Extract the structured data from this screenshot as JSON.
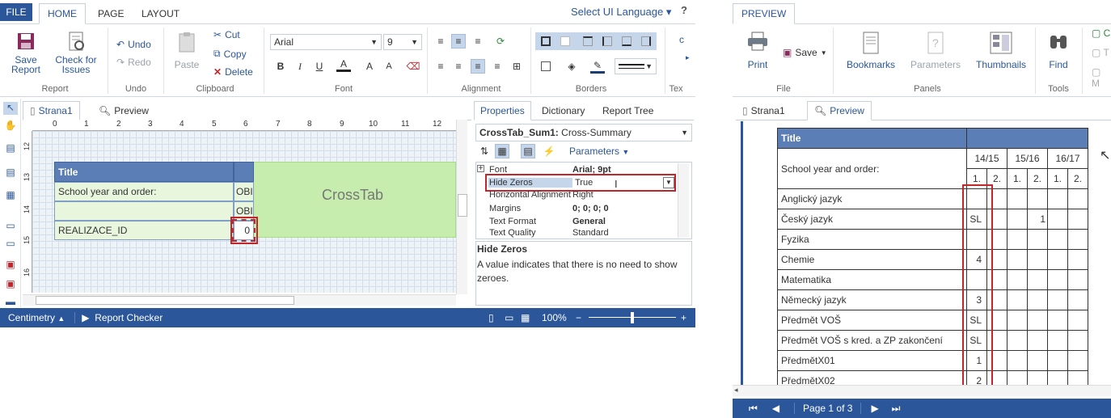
{
  "designer": {
    "tabs": {
      "file": "FILE",
      "home": "HOME",
      "page": "PAGE",
      "layout": "LAYOUT"
    },
    "ui_language": "Select UI Language",
    "help": "?",
    "ribbon": {
      "report": {
        "save": "Save Report",
        "check": "Check for Issues",
        "label": "Report"
      },
      "undo": {
        "undo": "Undo",
        "redo": "Redo",
        "label": "Undo"
      },
      "clipboard": {
        "paste": "Paste",
        "cut": "Cut",
        "copy": "Copy",
        "delete": "Delete",
        "label": "Clipboard"
      },
      "font": {
        "family": "Arial",
        "size": "9",
        "label": "Font",
        "bold": "B",
        "italic": "I",
        "underline": "U",
        "color": "A",
        "grow": "A",
        "shrink": "A"
      },
      "alignment": {
        "label": "Alignment"
      },
      "borders": {
        "label": "Borders"
      },
      "text": {
        "label": "Tex"
      }
    },
    "doc_tabs": {
      "page": "Strana1",
      "preview": "Preview"
    },
    "ruler_top": [
      "0",
      "1",
      "2",
      "3",
      "4",
      "5",
      "6",
      "7",
      "8",
      "9",
      "10",
      "11",
      "12"
    ],
    "ruler_left": [
      "12",
      "13",
      "14",
      "15",
      "16"
    ],
    "cells": {
      "title": "Title",
      "school_year": "School year and order:",
      "obi1": "OBI",
      "obi2": "OBI",
      "realizace": "REALIZACE_ID",
      "zero": "0",
      "crosstab": "CrossTab"
    },
    "properties": {
      "tabs": {
        "properties": "Properties",
        "dictionary": "Dictionary",
        "report_tree": "Report Tree"
      },
      "object": "CrossTab_Sum1:",
      "object_type": " Cross-Summary",
      "parameters": "Parameters",
      "rows": [
        {
          "key": "Font",
          "value": "Arial; 9pt"
        },
        {
          "key": "Hide Zeros",
          "value": "True"
        },
        {
          "key": "Horizontal Alignment",
          "value": "Right"
        },
        {
          "key": "Margins",
          "value": "0; 0; 0; 0"
        },
        {
          "key": "Text Format",
          "value": "General"
        },
        {
          "key": "Text Quality",
          "value": "Standard"
        }
      ],
      "desc_title": "Hide Zeros",
      "desc_text": "A value indicates that there is no need to show zeroes."
    },
    "status": {
      "unit": "Centimetry",
      "checker": "Report Checker",
      "zoom": "100%"
    }
  },
  "preview": {
    "tab": "PREVIEW",
    "ribbon": {
      "print": "Print",
      "save": "Save",
      "file_label": "File",
      "bookmarks": "Bookmarks",
      "parameters": "Parameters",
      "thumbnails": "Thumbnails",
      "panels_label": "Panels",
      "find": "Find",
      "tools_label": "Tools"
    },
    "doc_tabs": {
      "page": "Strana1",
      "preview": "Preview"
    },
    "table": {
      "title": "Title",
      "row_header": "School year and order:",
      "years": [
        "14/15",
        "15/16",
        "16/17"
      ],
      "orders": [
        "1.",
        "2.",
        "1.",
        "2.",
        "1.",
        "2."
      ],
      "rows": [
        {
          "name": "Anglický jazyk",
          "c1": "",
          "c3": ""
        },
        {
          "name": "Český jazyk",
          "c1": "SL",
          "c3": "1"
        },
        {
          "name": "Fyzika",
          "c1": "",
          "c3": ""
        },
        {
          "name": "Chemie",
          "c1": "4",
          "c3": ""
        },
        {
          "name": "Matematika",
          "c1": "",
          "c3": ""
        },
        {
          "name": "Německý jazyk",
          "c1": "3",
          "c3": ""
        },
        {
          "name": "Předmět VOŠ",
          "c1": "SL",
          "c3": ""
        },
        {
          "name": "Předmět VOŠ s kred. a ZP zakončení",
          "c1": "SL",
          "c3": ""
        },
        {
          "name": "PředmětX01",
          "c1": "1",
          "c3": ""
        },
        {
          "name": "PředmětX02",
          "c1": "2",
          "c3": ""
        }
      ]
    },
    "pager": "Page 1 of 3"
  },
  "colors": {
    "accent": "#2b579a",
    "title_band": "#5b7eb7",
    "crosstab_green": "#c6ecae",
    "highlight": "#c0272d"
  }
}
